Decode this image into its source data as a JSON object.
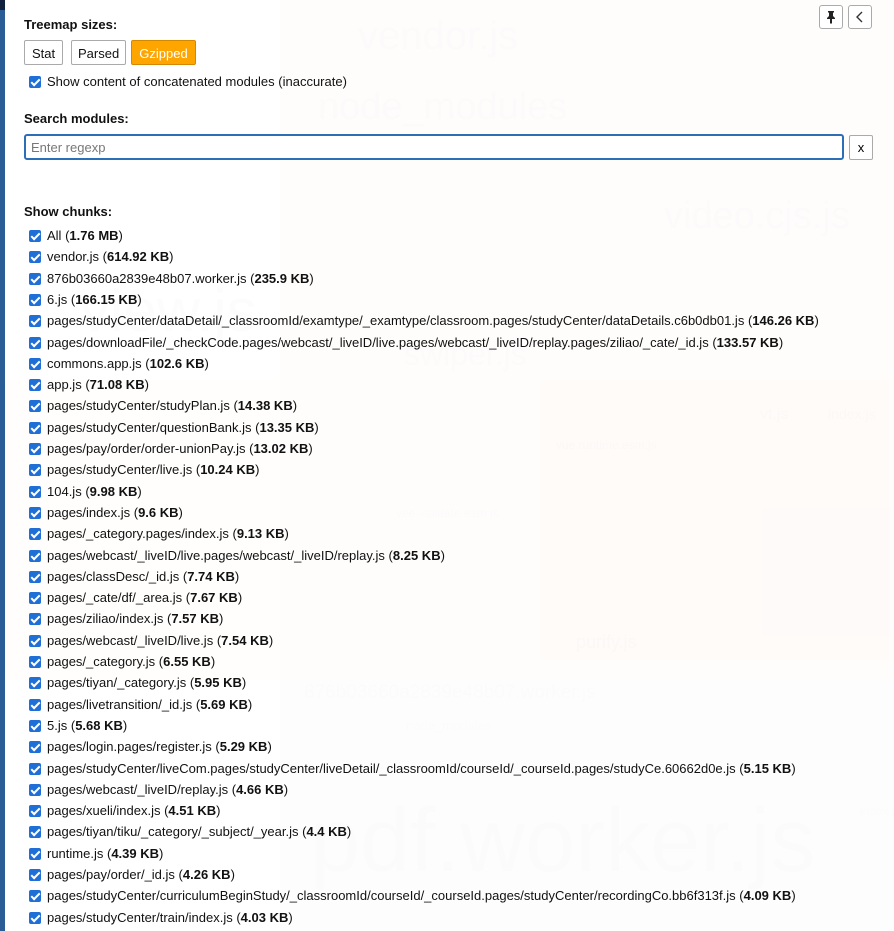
{
  "background_labels": [
    "vendor.js",
    "node_modules",
    "video.cjs.js",
    "view.js",
    "swiper.js",
    "vt.js",
    "index.js",
    "vue.runtime.esm.js",
    "vee-validate.esm.js",
    "purify.js",
    "876b03660a2839e48b07.worker.js",
    "node_modules",
    "pdf.worker.js",
    "index.js"
  ],
  "treemap_sizes": {
    "label": "Treemap sizes:",
    "buttons": [
      "Stat",
      "Parsed",
      "Gzipped"
    ],
    "active": "Gzipped"
  },
  "concat_option": {
    "label": "Show content of concatenated modules (inaccurate)",
    "checked": true
  },
  "search": {
    "label": "Search modules:",
    "placeholder": "Enter regexp",
    "value": "",
    "clear_label": "x"
  },
  "chunks": {
    "label": "Show chunks:",
    "items": [
      {
        "name": "All",
        "size": "1.76 MB"
      },
      {
        "name": "vendor.js",
        "size": "614.92 KB"
      },
      {
        "name": "876b03660a2839e48b07.worker.js",
        "size": "235.9 KB"
      },
      {
        "name": "6.js",
        "size": "166.15 KB"
      },
      {
        "name": "pages/studyCenter/dataDetail/_classroomId/examtype/_examtype/classroom.pages/studyCenter/dataDetails.c6b0db01.js",
        "size": "146.26 KB"
      },
      {
        "name": "pages/downloadFile/_checkCode.pages/webcast/_liveID/live.pages/webcast/_liveID/replay.pages/ziliao/_cate/_id.js",
        "size": "133.57 KB"
      },
      {
        "name": "commons.app.js",
        "size": "102.6 KB"
      },
      {
        "name": "app.js",
        "size": "71.08 KB"
      },
      {
        "name": "pages/studyCenter/studyPlan.js",
        "size": "14.38 KB"
      },
      {
        "name": "pages/studyCenter/questionBank.js",
        "size": "13.35 KB"
      },
      {
        "name": "pages/pay/order/order-unionPay.js",
        "size": "13.02 KB"
      },
      {
        "name": "pages/studyCenter/live.js",
        "size": "10.24 KB"
      },
      {
        "name": "104.js",
        "size": "9.98 KB"
      },
      {
        "name": "pages/index.js",
        "size": "9.6 KB"
      },
      {
        "name": "pages/_category.pages/index.js",
        "size": "9.13 KB"
      },
      {
        "name": "pages/webcast/_liveID/live.pages/webcast/_liveID/replay.js",
        "size": "8.25 KB"
      },
      {
        "name": "pages/classDesc/_id.js",
        "size": "7.74 KB"
      },
      {
        "name": "pages/_cate/df/_area.js",
        "size": "7.67 KB"
      },
      {
        "name": "pages/ziliao/index.js",
        "size": "7.57 KB"
      },
      {
        "name": "pages/webcast/_liveID/live.js",
        "size": "7.54 KB"
      },
      {
        "name": "pages/_category.js",
        "size": "6.55 KB"
      },
      {
        "name": "pages/tiyan/_category.js",
        "size": "5.95 KB"
      },
      {
        "name": "pages/livetransition/_id.js",
        "size": "5.69 KB"
      },
      {
        "name": "5.js",
        "size": "5.68 KB"
      },
      {
        "name": "pages/login.pages/register.js",
        "size": "5.29 KB"
      },
      {
        "name": "pages/studyCenter/liveCom.pages/studyCenter/liveDetail/_classroomId/courseId/_courseId.pages/studyCe.60662d0e.js",
        "size": "5.15 KB"
      },
      {
        "name": "pages/webcast/_liveID/replay.js",
        "size": "4.66 KB"
      },
      {
        "name": "pages/xueli/index.js",
        "size": "4.51 KB"
      },
      {
        "name": "pages/tiyan/tiku/_category/_subject/_year.js",
        "size": "4.4 KB"
      },
      {
        "name": "runtime.js",
        "size": "4.39 KB"
      },
      {
        "name": "pages/pay/order/_id.js",
        "size": "4.26 KB"
      },
      {
        "name": "pages/studyCenter/curriculumBeginStudy/_classroomId/courseId/_courseId.pages/studyCenter/recordingCo.bb6f313f.js",
        "size": "4.09 KB"
      },
      {
        "name": "pages/studyCenter/train/index.js",
        "size": "4.03 KB"
      }
    ]
  },
  "sidebar_controls": {
    "pin_icon": "pin-icon",
    "collapse_icon": "chevron-left-icon"
  },
  "colors": {
    "accent": "#ffa500",
    "checkbox": "#1f6fd6",
    "focus_border": "#2d6fb6",
    "window_edge": "#2a5d95"
  }
}
